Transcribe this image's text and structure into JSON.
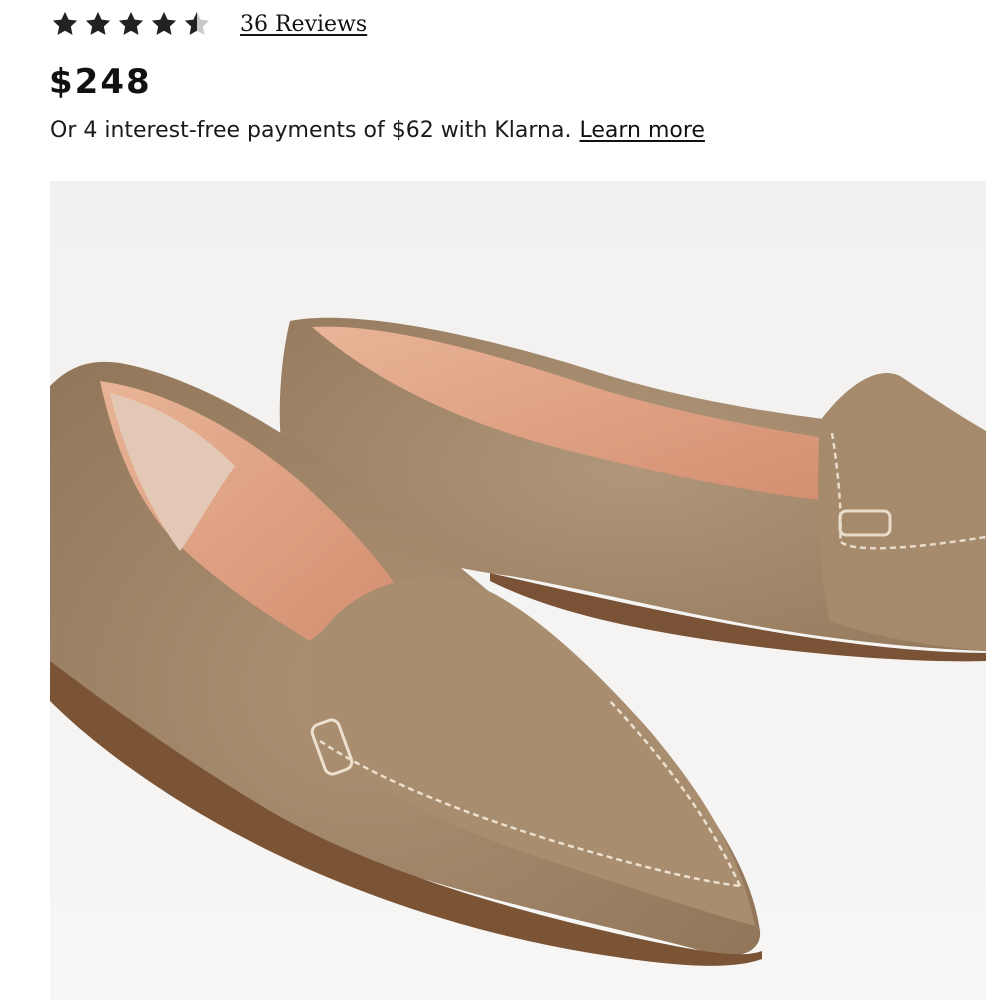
{
  "rating": {
    "value": 4.5,
    "max": 5,
    "reviews_label": "36 Reviews",
    "star_color": "#222222"
  },
  "price": {
    "label": "$248"
  },
  "klarna": {
    "text": "Or 4 interest-free payments of $62 with Klarna.",
    "link_label": "Learn more"
  },
  "product_image": {
    "background": "#f4f3f1",
    "suede_color": "#a88c6e",
    "lining_color": "#e0a486"
  }
}
